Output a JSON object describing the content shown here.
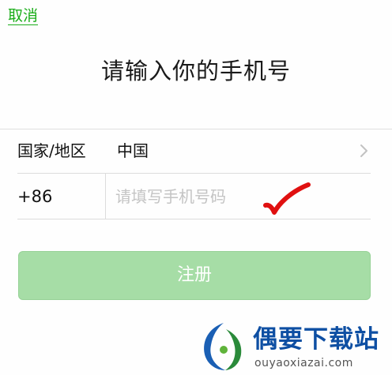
{
  "header": {
    "cancel_label": "取消",
    "title": "请输入你的手机号"
  },
  "form": {
    "country_label": "国家/地区",
    "country_value": "中国",
    "country_code": "+86",
    "phone_placeholder": "请填写手机号码",
    "phone_value": ""
  },
  "actions": {
    "register_label": "注册"
  },
  "watermark": {
    "title": "偶要下载站",
    "url": "ouyaoxiazai.com"
  },
  "colors": {
    "accent_green": "#1aad19",
    "button_disabled_green": "#a6dda6",
    "annotation_red": "#e01010"
  },
  "icons": {
    "chevron": "chevron-right-icon",
    "annotation": "checkmark-icon",
    "logo": "watermark-logo-icon"
  }
}
